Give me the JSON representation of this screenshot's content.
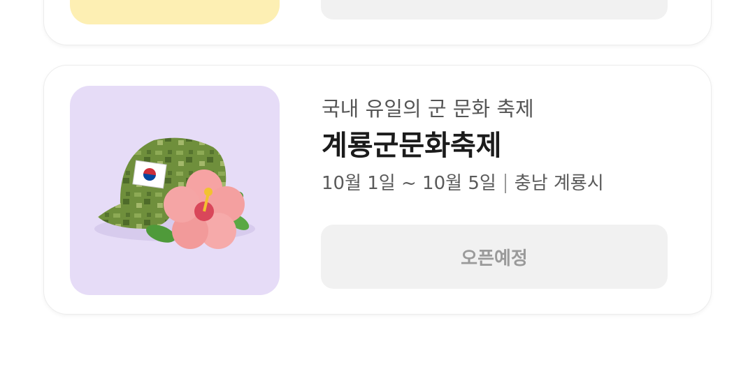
{
  "festival_card": {
    "subtitle": "국내 유일의 군 문화 축제",
    "title": "계룡군문화축제",
    "dates": "10월 1일 ~ 10월 5일",
    "location": "충남 계룡시",
    "status_button": "오픈예정",
    "image_icon": "camouflage-cap-with-hibiscus-icon"
  },
  "colors": {
    "thumb_bg": "#e6dcf7",
    "prev_thumb_bg": "#fdefb3",
    "button_bg": "#f1f1f1"
  }
}
